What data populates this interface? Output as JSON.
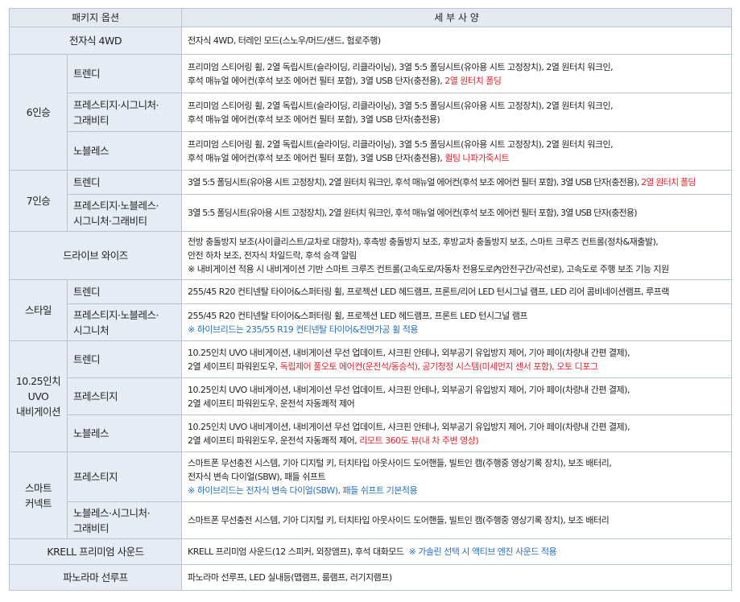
{
  "header": {
    "col_option": "패키지 옵션",
    "col_detail": "세 부 사 양"
  },
  "accent_colors": {
    "red": "#d7262f",
    "blue": "#2a6fb5",
    "label_bg": "#e6ebf4"
  },
  "rows": {
    "awd": {
      "group": "전자식 4WD",
      "detail": "전자식 4WD, 터레인 모드(스노우/머드/샌드, 험로주행)"
    },
    "seat6": {
      "group": "6인승",
      "trendy": {
        "label": "트렌디",
        "l1": "프리미엄 스티어링 휠, 2열 독립시트(슬라이딩, 리클라이닝), 3열 5:5 폴딩시트(유아용 시트 고정장치), 2열 원터치 워크인,",
        "l2": "후석 매뉴얼 에어컨(후석 보조 에어컨 필터 포함), 3열 USB 단자(충전용), ",
        "l2_red": "2열 원터치 폴딩"
      },
      "prestige": {
        "label_1": "프레스티지·시그니처·",
        "label_2": "그래비티",
        "l1": "프리미엄 스티어링 휠, 2열 독립시트(슬라이딩, 리클라이닝), 3열 5:5 폴딩시트(유아용 시트 고정장치), 2열 원터치 워크인,",
        "l2": "후석 매뉴얼 에어컨(후석 보조 에어컨 필터 포함), 3열 USB 단자(충전용)"
      },
      "noblesse": {
        "label": "노블레스",
        "l1": "프리미엄 스티어링 휠, 2열 독립시트(슬라이딩, 리클라이닝), 3열 5:5 폴딩시트(유아용 시트 고정장치), 2열 원터치 워크인,",
        "l2": "후석 매뉴얼 에어컨(후석 보조 에어컨 필터 포함), 3열 USB 단자(충전용), ",
        "l2_red": "퀼팅 나파가죽시트"
      }
    },
    "seat7": {
      "group": "7인승",
      "trendy": {
        "label": "트렌디",
        "l1": "3열 5:5 폴딩시트(유아용 시트 고정장치), 2열 원터치 워크인, 후석 매뉴얼 에어컨(후석 보조 에어컨 필터 포함), 3열 USB 단자(충전용), ",
        "l1_red": "2열 원터치 폴딩"
      },
      "prestige": {
        "label_1": "프레스티지·노블레스·",
        "label_2": "시그니처·그래비티",
        "l1": "3열 5:5 폴딩시트(유아용 시트 고정장치), 2열 원터치 워크인, 후석 매뉴얼 에어컨(후석 보조 에어컨 필터 포함), 3열 USB 단자(충전용)"
      }
    },
    "drivewise": {
      "group": "드라이브 와이즈",
      "l1": "전방 충돌방지 보조(사이클리스트/교차로 대향차), 후측방 충돌방지 보조, 후방교차 충돌방지 보조, 스마트 크루즈 컨트롤(정차&재출발),",
      "l2": "안전 하차 보조, 전자식 차일드락, 후석 승객 알림",
      "l3": "※ 내비게이션 적용 시 내비게이션 기반 스마트 크루즈 컨트롤(고속도로/자동차 전용도로內안전구간/곡선로), 고속도로 주행 보조 기능 지원"
    },
    "style": {
      "group": "스타일",
      "trendy": {
        "label": "트렌디",
        "l1": "255/45 R20 컨티넨탈 타이어&스퍼터링 휠, 프로젝션 LED 헤드램프, 프론트/리어 LED 턴시그널 램프, LED 리어 콤비네이션램프, 루프랙"
      },
      "prestige": {
        "label_1": "프레스티지·노블레스·",
        "label_2": "시그니처",
        "l1": "255/45 R20 컨티넨탈 타이어&스퍼터링 휠, 프로젝션 LED 헤드램프, 프론트 LED 턴시그널 램프",
        "l2_blue": "※ 하이브리드는 235/55 R19 컨티넨탈 타이어&전면가공 휠 적용"
      }
    },
    "navi": {
      "group_1": "10.25인치",
      "group_2": "UVO",
      "group_3": "내비게이션",
      "trendy": {
        "label": "트렌디",
        "l1": "10.25인치 UVO 내비게이션, 내비게이션 무선 업데이트, 샤크핀 안테나, 외부공기 유입방지 제어, 기아 페이(차량내 간편 결제),",
        "l2": "2열 세이프티 파워윈도우, ",
        "l2_red": "독립제어 풀오토 에어컨(운전석/동승석), 공기청정 시스템(미세먼지 센서 포함), 오토 디포그"
      },
      "prestige": {
        "label": "프레스티지",
        "l1": "10.25인치 UVO 내비게이션, 내비게이션 무선 업데이트, 샤크핀 안테나, 외부공기 유입방지 제어, 기아 페이(차량내 간편 결제),",
        "l2": "2열 세이프티 파워윈도우, 운전석 자동쾌적 제어"
      },
      "noblesse": {
        "label": "노블레스",
        "l1": "10.25인치 UVO 내비게이션, 내비게이션 무선 업데이트, 샤크핀 안테나, 외부공기 유입방지 제어, 기아 페이(차량내 간편 결제),",
        "l2": "2열 세이프티 파워윈도우, 운전석 자동쾌적 제어, ",
        "l2_red": "리모트 360도 뷰(내 차 주변 영상)"
      }
    },
    "smart": {
      "group_1": "스마트",
      "group_2": "커넥트",
      "prestige": {
        "label": "프레스티지",
        "l1": "스마트폰 무선충전 시스템, 기아 디지털 키, 터치타입 아웃사이드 도어핸들, 빌트인 캠(주행중 영상기록 장치), 보조 배터리,",
        "l2": "전자식 변속 다이얼(SBW), 패들 쉬프트",
        "l3_blue": "※ 하이브리드는 전자식 변속 다이얼(SBW), 패들 쉬프트 기본적용"
      },
      "noblesse": {
        "label_1": "노블레스·시그니처·",
        "label_2": "그래비티",
        "l1": "스마트폰 무선충전 시스템, 기아 디지털 키, 터치타입 아웃사이드 도어핸들, 빌트인 캠(주행중 영상기록 장치), 보조 배터리"
      }
    },
    "krell": {
      "group": "KRELL 프리미엄 사운드",
      "l1": "KRELL 프리미엄 사운드(12 스피커, 외장앰프), 후석 대화모드  ",
      "l1_blue": "※ 가솔린 선택 시 액티브 엔진 사운드 적용"
    },
    "panorama": {
      "group": "파노라마 선루프",
      "l1": "파노라마 선루프, LED 실내등(맵램프, 룸램프, 러기지램프)"
    }
  }
}
